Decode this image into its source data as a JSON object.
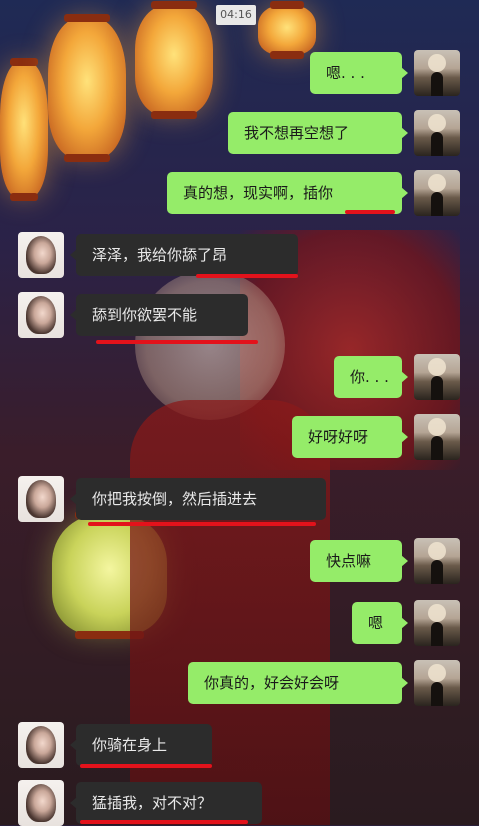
{
  "status_bar": {
    "time": "04:16"
  },
  "messages": [
    {
      "side": "me",
      "text": "嗯. . ."
    },
    {
      "side": "me",
      "text": "我不想再空想了"
    },
    {
      "side": "me",
      "text": "真的想，现实啊，插你"
    },
    {
      "side": "her",
      "text": "泽泽，我给你舔了昂"
    },
    {
      "side": "her",
      "text": "舔到你欲罢不能"
    },
    {
      "side": "me",
      "text": "你. . ."
    },
    {
      "side": "me",
      "text": "好呀好呀"
    },
    {
      "side": "her",
      "text": "你把我按倒，然后插进去"
    },
    {
      "side": "me",
      "text": "快点嘛"
    },
    {
      "side": "me",
      "text": "嗯"
    },
    {
      "side": "me",
      "text": "你真的，好会好会呀"
    },
    {
      "side": "her",
      "text": "你骑在身上"
    },
    {
      "side": "her",
      "text": "猛插我，对不对？"
    }
  ],
  "colors": {
    "my_bubble": "#95ec69",
    "her_bubble": "#2c2c2c",
    "underline_annotation": "#e3121b"
  }
}
